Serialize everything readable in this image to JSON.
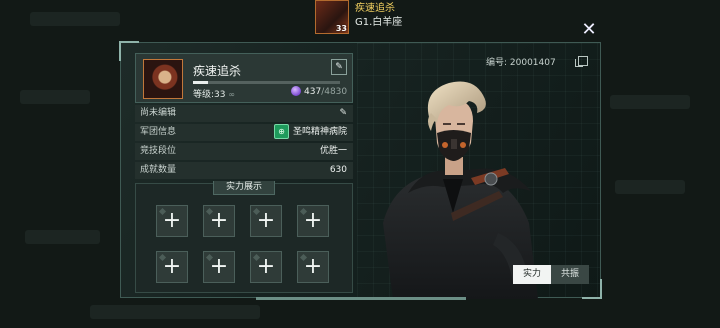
{
  "header": {
    "player_name": "疾速追杀",
    "player_level": "33",
    "server": "G1.白羊座"
  },
  "profile": {
    "name": "疾速追杀",
    "edit_icon": "edit-icon",
    "level_label": "等级:33",
    "level_symbol": "∞",
    "exp_progress": 0.1,
    "currency_current": "437",
    "currency_max": "/4830",
    "id_label": "编号: 20001407"
  },
  "info_rows": [
    {
      "label": "尚未编辑",
      "value": ""
    },
    {
      "label": "军团信息",
      "value": "圣鸣精神病院"
    },
    {
      "label": "竞技段位",
      "value": "优胜一"
    },
    {
      "label": "成就数量",
      "value": "630"
    }
  ],
  "showcase": {
    "title": "实力展示",
    "slot_symbol": "+"
  },
  "tabs": [
    {
      "label": "实力",
      "active": true
    },
    {
      "label": "共振",
      "active": false
    }
  ],
  "colors": {
    "accent_gold": "#f2d060",
    "guild_green": "#1f9a5c",
    "currency_purple": "#7b4ad1"
  }
}
